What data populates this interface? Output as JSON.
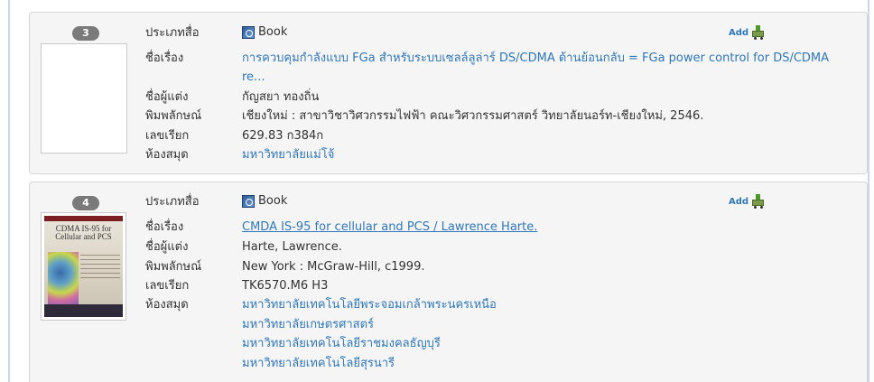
{
  "records": [
    {
      "number": "3",
      "labels": {
        "type": "ประเภทสื่อ",
        "title": "ชื่อเรื่อง",
        "author": "ชื่อผู้แต่ง",
        "publisher": "พิมพลักษณ์",
        "call_number": "เลขเรียก",
        "library": "ห้องสมุด"
      },
      "type": "Book",
      "title_line1": "การควบคุมกำลังแบบ FGa สำหรับระบบเซลล์ลูล่าร์ DS/CDMA ด้านย้อนกลับ = FGa power control for DS/CDMA",
      "title_line2": "re...",
      "author": "กัญสยา ทองถิ่น",
      "publisher": "เชียงใหม่ : สาขาวิชาวิศวกรรมไฟฟ้า คณะวิศวกรรมศาสตร์ วิทยาลัยนอร์ท-เชียงใหม่, 2546.",
      "call_number": "629.83 ก384ก",
      "libraries": [
        "มหาวิทยาลัยแม่โจ้"
      ],
      "add_label": "Add"
    },
    {
      "number": "4",
      "labels": {
        "type": "ประเภทสื่อ",
        "title": "ชื่อเรื่อง",
        "author": "ชื่อผู้แต่ง",
        "publisher": "พิมพลักษณ์",
        "call_number": "เลขเรียก",
        "library": "ห้องสมุด"
      },
      "type": "Book",
      "title_line1": "CMDA IS-95 for cellular and PCS / Lawrence Harte.",
      "author": "Harte, Lawrence.",
      "publisher": "New York : McGraw-Hill, c1999.",
      "call_number": "TK6570.M6 H3",
      "libraries": [
        "มหาวิทยาลัยเทคโนโลยีพระจอมเกล้าพระนครเหนือ",
        "มหาวิทยาลัยเกษตรศาสตร์",
        "มหาวิทยาลัยเทคโนโลยีราชมงคลธัญบุรี",
        "มหาวิทยาลัยเทคโนโลยีสุรนารี"
      ],
      "add_label": "Add",
      "cover_text": "CDMA IS-95 for Cellular and PCS"
    }
  ]
}
